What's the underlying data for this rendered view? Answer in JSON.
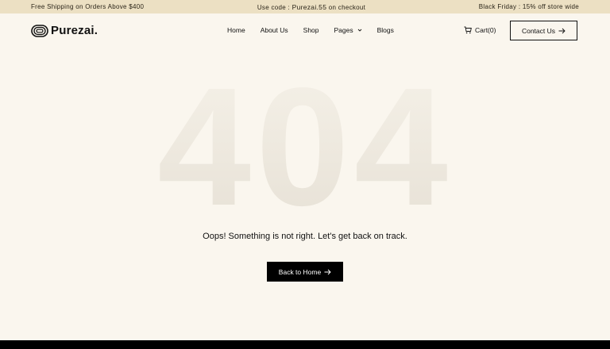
{
  "topbar": {
    "left": "Free Shipping on Orders Above $400",
    "mid_prefix": "Use code : ",
    "mid_code": "Purezai.55",
    "mid_suffix": " on checkout",
    "right": "Black Friday : 15% off store wide"
  },
  "brand": {
    "name": "Purezai."
  },
  "nav": {
    "items": [
      "Home",
      "About Us",
      "Shop",
      "Pages",
      "Blogs"
    ]
  },
  "cart": {
    "label": "Cart(0)"
  },
  "contact": {
    "label": "Contact Us"
  },
  "error": {
    "code": "404",
    "message": "Oops! Something is not right. Let's get back on track.",
    "button": "Back to Home"
  },
  "colors": {
    "background": "#faf6ee",
    "topbar": "#ece0c3",
    "accent": "#000000"
  }
}
